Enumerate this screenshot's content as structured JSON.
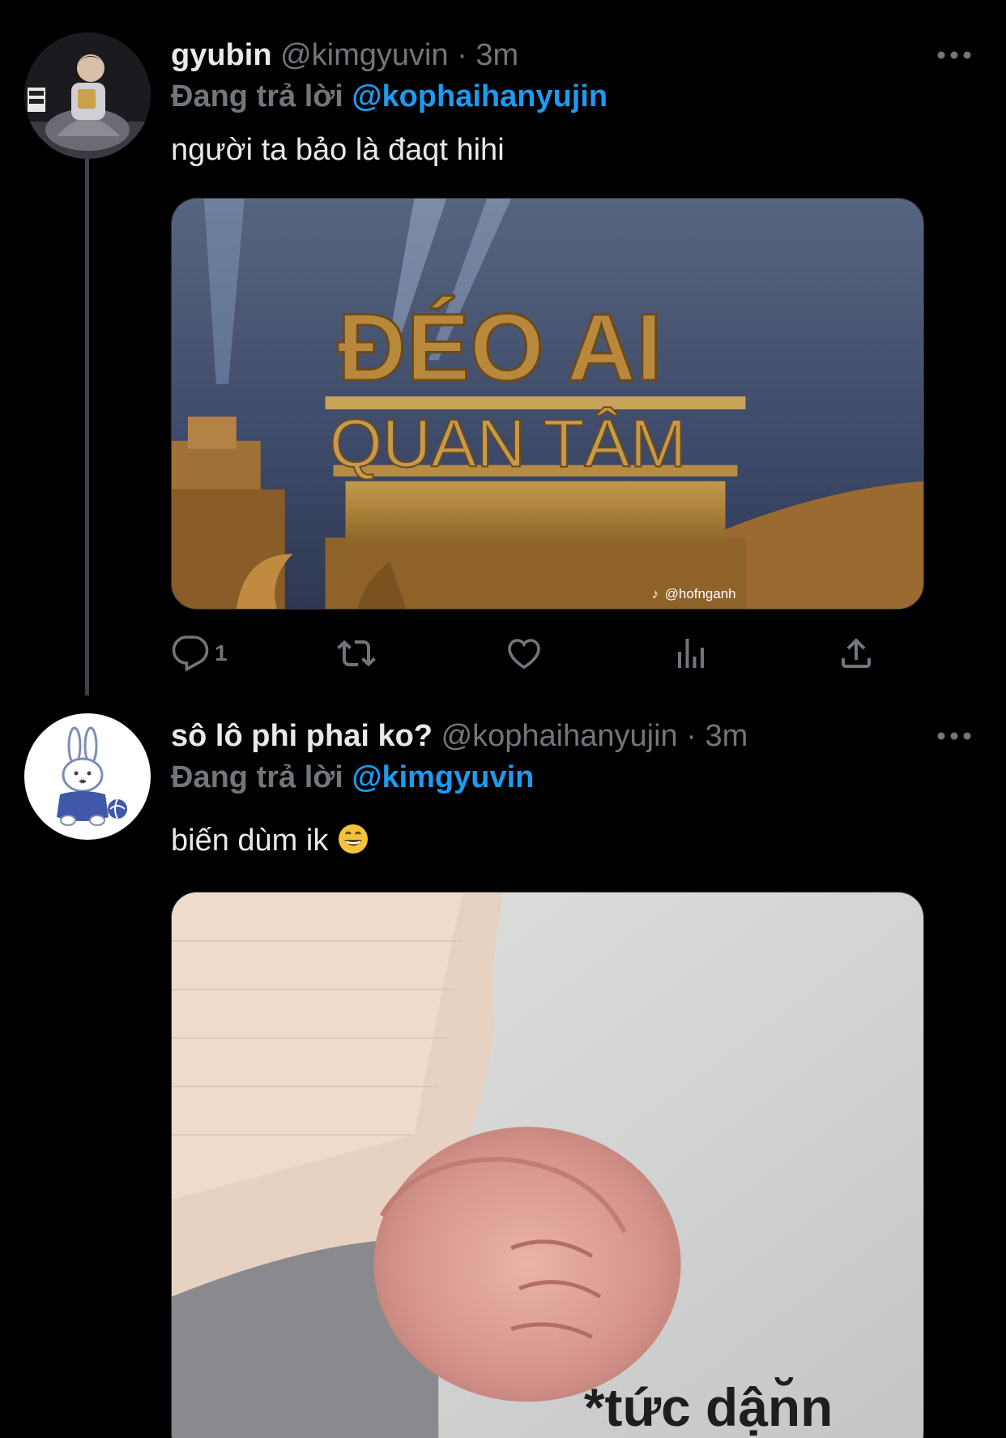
{
  "tweets": [
    {
      "display_name": "gyubin",
      "handle": "@kimgyuvin",
      "separator": "·",
      "time": "3m",
      "reply_prefix": "Đang trả lời",
      "reply_to": "@kophaihanyujin",
      "text": "người ta bảo là đaqt hihi",
      "media": {
        "line1": "ĐÉO AI",
        "line2": "QUAN TÂM",
        "watermark": "@hofnganh"
      },
      "actions": {
        "reply_count": "1"
      }
    },
    {
      "display_name": "sô lô phi phai ko?",
      "handle": "@kophaihanyujin",
      "separator": "·",
      "time": "3m",
      "reply_prefix": "Đang trả lời",
      "reply_to": "@kimgyuvin",
      "text": "biến dùm ik",
      "media": {
        "caption": "*tức dận̆n"
      }
    }
  ],
  "icons": {
    "more": "more-icon",
    "reply": "reply-icon",
    "retweet": "retweet-icon",
    "like": "heart-icon",
    "views": "views-icon",
    "share": "share-icon",
    "emoji": "grinning-face-emoji"
  },
  "colors": {
    "background": "#000000",
    "text": "#e7e9ea",
    "muted": "#71767b",
    "accent": "#1d9bf0"
  }
}
